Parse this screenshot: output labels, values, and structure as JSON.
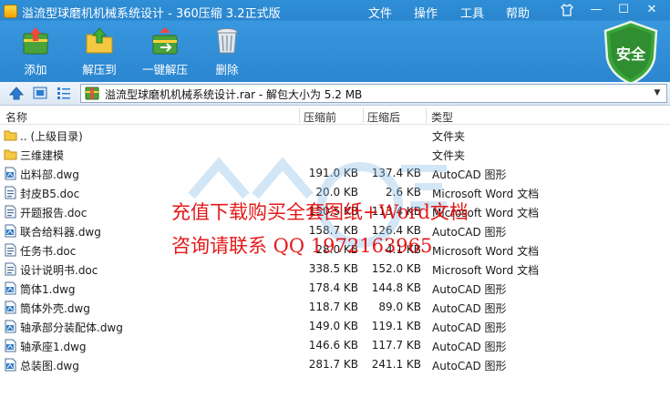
{
  "window": {
    "title": "溢流型球磨机机械系统设计 - 360压缩 3.2正式版",
    "menu": [
      "文件",
      "操作",
      "工具",
      "帮助"
    ],
    "controls": {
      "minimize": "—",
      "maximize": "☐",
      "close": "✕"
    }
  },
  "toolbar": {
    "add_label": "添加",
    "extract_label": "解压到",
    "one_click_label": "一键解压",
    "delete_label": "删除",
    "safe_badge": "安全"
  },
  "address": {
    "path": "溢流型球磨机机械系统设计.rar - 解包大小为 5.2 MB"
  },
  "columns": {
    "name": "名称",
    "packed": "压缩前",
    "original": "压缩后",
    "type": "类型"
  },
  "files": [
    {
      "name": ".. (上级目录)",
      "packed": "",
      "original": "",
      "type": "文件夹",
      "kind": "folder"
    },
    {
      "name": "三维建模",
      "packed": "",
      "original": "",
      "type": "文件夹",
      "kind": "folder"
    },
    {
      "name": "出料部.dwg",
      "packed": "191.0 KB",
      "original": "137.4 KB",
      "type": "AutoCAD 图形",
      "kind": "dwg"
    },
    {
      "name": "封皮B5.doc",
      "packed": "20.0 KB",
      "original": "2.6 KB",
      "type": "Microsoft Word 文档",
      "kind": "doc"
    },
    {
      "name": "开题报告.doc",
      "packed": "150.5 KB",
      "original": "113.4 KB",
      "type": "Microsoft Word 文档",
      "kind": "doc"
    },
    {
      "name": "联合给料器.dwg",
      "packed": "158.7 KB",
      "original": "126.4 KB",
      "type": "AutoCAD 图形",
      "kind": "dwg"
    },
    {
      "name": "任务书.doc",
      "packed": "28.0 KB",
      "original": "4.1 KB",
      "type": "Microsoft Word 文档",
      "kind": "doc"
    },
    {
      "name": "设计说明书.doc",
      "packed": "338.5 KB",
      "original": "152.0 KB",
      "type": "Microsoft Word 文档",
      "kind": "doc"
    },
    {
      "name": "筒体1.dwg",
      "packed": "178.4 KB",
      "original": "144.8 KB",
      "type": "AutoCAD 图形",
      "kind": "dwg"
    },
    {
      "name": "筒体外壳.dwg",
      "packed": "118.7 KB",
      "original": "89.0 KB",
      "type": "AutoCAD 图形",
      "kind": "dwg"
    },
    {
      "name": "轴承部分装配体.dwg",
      "packed": "149.0 KB",
      "original": "119.1 KB",
      "type": "AutoCAD 图形",
      "kind": "dwg"
    },
    {
      "name": "轴承座1.dwg",
      "packed": "146.6 KB",
      "original": "117.7 KB",
      "type": "AutoCAD 图形",
      "kind": "dwg"
    },
    {
      "name": "总装图.dwg",
      "packed": "281.7 KB",
      "original": "241.1 KB",
      "type": "AutoCAD 图形",
      "kind": "dwg"
    }
  ],
  "watermark": {
    "line1": "充值下载购买全套图纸+Word文档",
    "line2": "咨询请联系 QQ 1972163965"
  }
}
